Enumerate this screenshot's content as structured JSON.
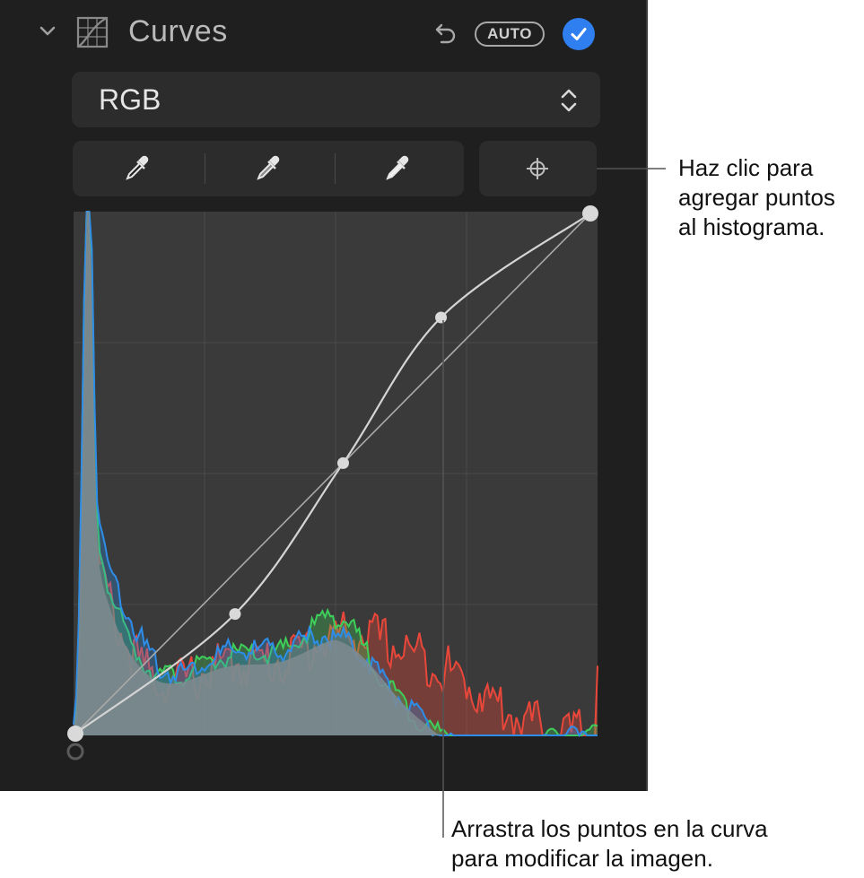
{
  "header": {
    "title": "Curves",
    "auto_label": "AUTO"
  },
  "channel": {
    "selected": "RGB"
  },
  "callouts": {
    "add_points": [
      "Haz clic para",
      "agregar puntos",
      "al histograma."
    ],
    "drag_points": [
      "Arrastra los puntos en la curva",
      "para modificar la imagen."
    ]
  },
  "colors": {
    "panel_bg": "#1f1f1f",
    "accent": "#2f7ff0",
    "hist_red": "#e8473a",
    "hist_green": "#3ecf5a",
    "hist_blue": "#2e8de8",
    "curve": "#d0d0d0"
  },
  "icons": [
    "chevron-down-icon",
    "curves-icon",
    "undo-icon",
    "checkmark-icon",
    "up-down-chevron-icon",
    "eyedropper-black-icon",
    "eyedropper-gray-icon",
    "eyedropper-white-icon",
    "crosshair-icon"
  ],
  "curve_points": [
    {
      "input": 0.0,
      "output": 0.0
    },
    {
      "input": 0.31,
      "output": 0.23
    },
    {
      "input": 0.52,
      "output": 0.52
    },
    {
      "input": 0.71,
      "output": 0.8
    },
    {
      "input": 1.0,
      "output": 1.0
    }
  ]
}
